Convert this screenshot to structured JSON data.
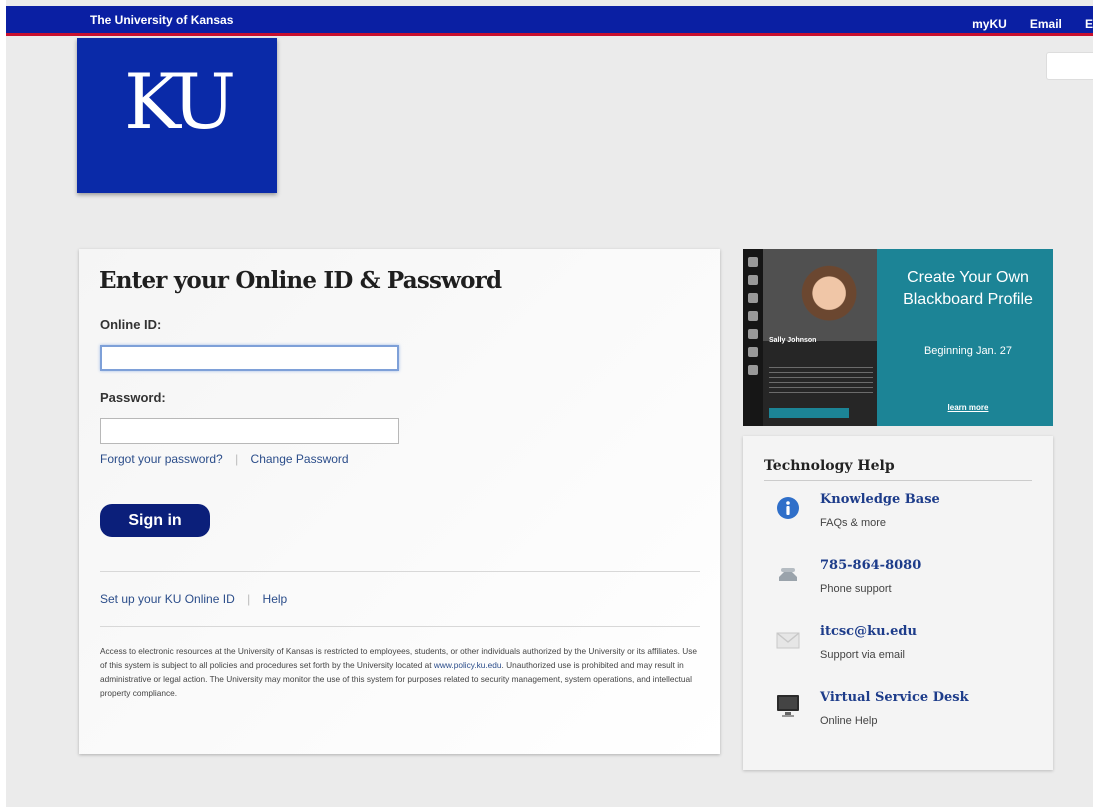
{
  "header": {
    "university": "The University of Kansas",
    "links": [
      "myKU",
      "Email",
      "E"
    ]
  },
  "logo": {
    "text": "KU"
  },
  "login": {
    "heading": "Enter your Online ID & Password",
    "online_id_label": "Online ID:",
    "online_id_value": "",
    "password_label": "Password:",
    "password_value": "",
    "forgot_link": "Forgot your password?",
    "separator": "|",
    "change_link": "Change Password",
    "signin_label": "Sign in",
    "setup_link": "Set up your KU Online ID",
    "help_link": "Help",
    "disclaimer_part1": "Access to electronic resources at the University of Kansas is restricted to employees, students, or other individuals authorized by the University or its affiliates. Use of this system is subject to all policies and procedures set forth by the University located at ",
    "disclaimer_link": "www.policy.ku.edu",
    "disclaimer_part2": ". Unauthorized use is prohibited and may result in administrative or legal action. The University may monitor the use of this system for purposes related to security management, system operations, and intellectual property compliance."
  },
  "promo": {
    "headline": "Create Your Own Blackboard Profile",
    "subline": "Beginning Jan. 27",
    "profile_name": "Sally Johnson",
    "learn_more": "learn more"
  },
  "tech_help": {
    "title": "Technology Help",
    "items": [
      {
        "title": "Knowledge Base",
        "desc": "FAQs & more",
        "icon": "info-icon"
      },
      {
        "title": "785-864-8080",
        "desc": "Phone support",
        "icon": "phone-icon"
      },
      {
        "title": "itcsc@ku.edu",
        "desc": "Support via email",
        "icon": "mail-icon"
      },
      {
        "title": "Virtual Service Desk",
        "desc": "Online Help",
        "icon": "monitor-icon"
      }
    ]
  },
  "colors": {
    "ku_blue": "#0a2aa8",
    "header_blue": "#0a1fa3",
    "accent_red": "#c8102e",
    "promo_teal": "#1c8496",
    "link_blue": "#2b4d8a"
  }
}
